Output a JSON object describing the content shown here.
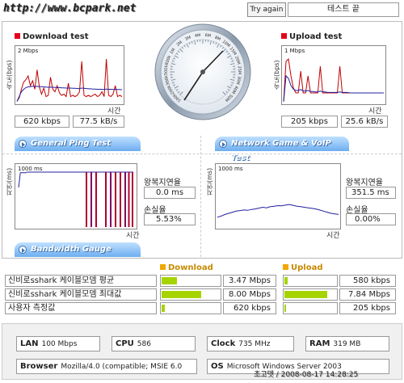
{
  "header": {
    "url": "http://www.bcpark.net",
    "try_again": "Try again",
    "test_end": "테스트 끝"
  },
  "download": {
    "title": "Download test",
    "axis_y": "속도(bps)",
    "plot_label": "2 Mbps",
    "axis_x": "시간",
    "kbps": "620 kbps",
    "kBps": "77.5 kB/s",
    "chart_data": {
      "type": "line",
      "title": "Download test",
      "ylabel": "속도(bps)",
      "xlabel": "시간",
      "ylim": [
        0,
        2
      ],
      "y_unit": "Mbps",
      "series": [
        {
          "color": "#c00000",
          "values": [
            0.05,
            0.2,
            0.55,
            0.85,
            0.95,
            1.1,
            0.7,
            0.9,
            0.55,
            1.35,
            0.65,
            0.35,
            0.6,
            0.25,
            0.3,
            1.05,
            0.55,
            0.45,
            0.7,
            0.4,
            0.3,
            0.35,
            0.25,
            0.8,
            0.25,
            0.3,
            0.25,
            0.3,
            0.45,
            1.7,
            0.3,
            0.25,
            0.3,
            0.25,
            0.3,
            0.35,
            0.25,
            0.3,
            0.45,
            0.25,
            1.8,
            0.3,
            0.25,
            0.35,
            0.7,
            0.25,
            0.3,
            0.25
          ]
        },
        {
          "color": "#2020a0",
          "values": [
            0.05,
            0.25,
            0.45,
            0.55,
            0.62,
            0.65,
            0.66,
            0.68,
            0.66,
            0.67,
            0.66,
            0.66,
            0.65,
            0.64,
            0.63,
            0.64,
            0.63,
            0.63,
            0.62,
            0.62,
            0.61,
            0.61,
            0.6,
            0.6,
            0.6,
            0.59,
            0.59,
            0.58,
            0.58,
            0.6,
            0.59,
            0.58,
            0.57,
            0.57,
            0.56,
            0.56,
            0.55,
            0.55,
            0.55,
            0.54,
            0.56,
            0.55,
            0.55,
            0.54,
            0.55,
            0.54,
            0.54,
            0.53
          ]
        }
      ]
    }
  },
  "upload": {
    "title": "Upload test",
    "axis_y": "속도(bps)",
    "plot_label": "1 Mbps",
    "axis_x": "시간",
    "kbps": "205 kbps",
    "kBps": "25.6 kB/s",
    "chart_data": {
      "type": "line",
      "title": "Upload test",
      "ylabel": "속도(bps)",
      "xlabel": "시간",
      "ylim": [
        0,
        1
      ],
      "y_unit": "Mbps",
      "series": [
        {
          "color": "#c00000",
          "values": [
            0.02,
            0.85,
            0.9,
            0.55,
            0.3,
            0.2,
            0.2,
            0.65,
            0.2,
            0.2,
            0.55,
            0.2,
            0.2,
            0.2,
            0.2,
            0.75,
            0.2,
            0.2,
            0.2,
            0.2,
            0.2,
            0.2,
            0.2,
            0.75,
            0.2,
            0.2,
            0.2,
            0.2,
            0.2,
            0.2,
            0.2,
            0.2,
            0.2,
            0.2,
            0.2,
            0.2,
            0.2,
            0.2,
            0.2,
            0.2,
            0.2,
            0.2
          ]
        },
        {
          "color": "#2020a0",
          "values": [
            0.02,
            0.55,
            0.5,
            0.35,
            0.28,
            0.25,
            0.25,
            0.27,
            0.24,
            0.24,
            0.25,
            0.23,
            0.23,
            0.22,
            0.22,
            0.24,
            0.22,
            0.22,
            0.21,
            0.21,
            0.21,
            0.21,
            0.21,
            0.22,
            0.21,
            0.21,
            0.21,
            0.2,
            0.2,
            0.2,
            0.2,
            0.2,
            0.2,
            0.2,
            0.2,
            0.2,
            0.2,
            0.2,
            0.2,
            0.2,
            0.2,
            0.2
          ]
        }
      ]
    }
  },
  "gauge": {
    "ticks": [
      "100k",
      "200k",
      "300k",
      "500k",
      "800k",
      "1M",
      "2M",
      "3M",
      "4M",
      "6M",
      "8M",
      "10M",
      "15M",
      "20M",
      "25M",
      "30M",
      "40M",
      "50M"
    ]
  },
  "general_ping": {
    "tab_label": "General Ping Test",
    "axis_y": "지연(ms)",
    "plot_label": "1000 ms",
    "axis_x": "시간",
    "rtt_label": "왕복지연율",
    "rtt_value": "0.0 ms",
    "loss_label": "손실율",
    "loss_value": "5.53%",
    "chart_data": {
      "type": "bar",
      "ylabel": "지연(ms)",
      "xlabel": "시간",
      "ylim": [
        0,
        1000
      ],
      "y_unit": "ms",
      "lost_packet_positions": [
        0.58,
        0.62,
        0.66,
        0.74,
        0.78,
        0.82,
        0.86,
        0.9,
        0.93,
        0.96
      ],
      "series": [
        {
          "values": [
            720,
            850,
            990,
            990,
            990,
            990,
            990,
            990,
            990,
            990
          ]
        }
      ]
    }
  },
  "network_game": {
    "tab_label": "Network Game & VoIP Test",
    "axis_y": "지연(ms)",
    "plot_label": "1000 ms",
    "axis_x": "시간",
    "rtt_label": "왕복지연율",
    "rtt_value": "351.5 ms",
    "loss_label": "손실율",
    "loss_value": "0.00%",
    "chart_data": {
      "type": "line",
      "ylabel": "지연(ms)",
      "xlabel": "시간",
      "ylim": [
        0,
        1000
      ],
      "y_unit": "ms",
      "series": [
        {
          "values": [
            180,
            200,
            230,
            250,
            270,
            290,
            300,
            310,
            305,
            320,
            330,
            345,
            360,
            350,
            370,
            380,
            390,
            385,
            400,
            410,
            395,
            380,
            370,
            360,
            350,
            340,
            330,
            310,
            290,
            270,
            250,
            240,
            230
          ]
        }
      ]
    }
  },
  "bandwidth": {
    "tab_label": "Bandwidth Gauge",
    "download_head": "Download",
    "upload_head": "Upload",
    "rows": [
      {
        "label": "신비로sshark 케이블모뎀 평균",
        "dl_value": "3.47 Mbps",
        "dl_fill": 0.27,
        "ul_value": "580 kbps",
        "ul_fill": 0.07
      },
      {
        "label": "신비로sshark 케이블모뎀 최대값",
        "dl_value": "8.00 Mbps",
        "dl_fill": 0.7,
        "ul_value": "7.84 Mbps",
        "ul_fill": 0.85
      },
      {
        "label": "사용자 측정값",
        "dl_value": "620 kbps",
        "dl_fill": 0.05,
        "ul_value": "205 kbps",
        "ul_fill": 0.03
      }
    ]
  },
  "sysinfo": {
    "lan_label": "LAN",
    "lan_value": "100 Mbps",
    "cpu_label": "CPU",
    "cpu_value": "586",
    "clock_label": "Clock",
    "clock_value": "735 MHz",
    "ram_label": "RAM",
    "ram_value": "319 MB",
    "browser_label": "Browser",
    "browser_value": "Mozilla/4.0 (compatible; MSIE 6.0",
    "os_label": "OS",
    "os_value": "Microsoft Windows Server 2003"
  },
  "footer": {
    "text": "초고뎃 / 2008-08-17 14:28:25"
  },
  "colors": {
    "accent_red": "#e4001b",
    "tab_blue": "#6eaef0",
    "bar_green": "#a6d400",
    "line_red": "#c00000",
    "line_blue": "#2020a0"
  }
}
